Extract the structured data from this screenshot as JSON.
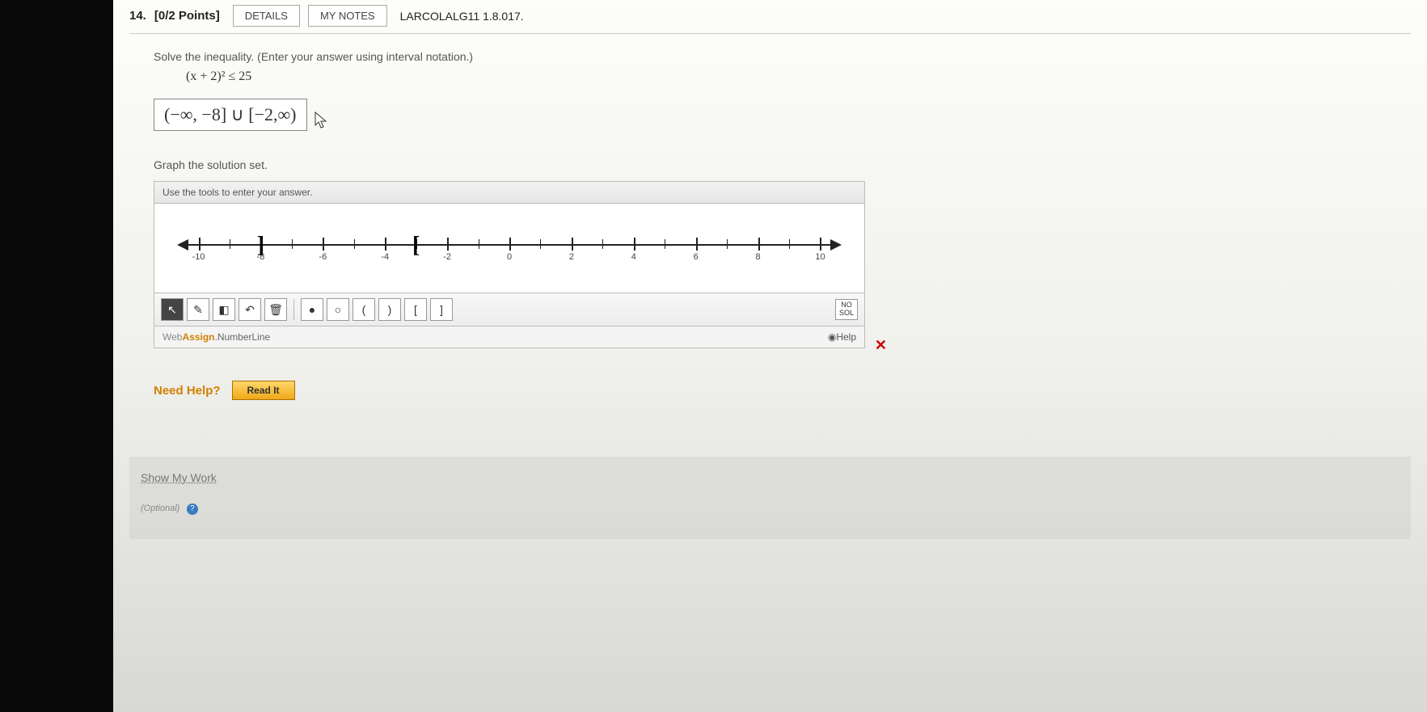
{
  "header": {
    "number": "14.",
    "points": "[0/2 Points]",
    "details_btn": "DETAILS",
    "notes_btn": "MY NOTES",
    "code": "LARCOLALG11 1.8.017."
  },
  "problem": {
    "instruction": "Solve the inequality. (Enter your answer using interval notation.)",
    "equation": "(x + 2)² ≤ 25",
    "answer": "(−∞, −8] ∪ [−2,∞)"
  },
  "graph": {
    "label": "Graph the solution set.",
    "panel_title": "Use the tools to enter your answer.",
    "ticks": [
      -10,
      -8,
      -6,
      -4,
      -2,
      0,
      2,
      4,
      6,
      8,
      10
    ],
    "brackets": [
      {
        "pos": -8,
        "sym": "]"
      },
      {
        "pos": -3,
        "sym": "["
      }
    ],
    "brand_wa": "Web",
    "brand_assign": "Assign",
    "brand_suffix": ".NumberLine",
    "help": "Help",
    "nosol_top": "NO",
    "nosol_bot": "SOL",
    "tools": {
      "pointer": "↖",
      "pencil": "✎",
      "eraser": "◧",
      "undo": "↶",
      "trash": "🗑",
      "closed_pt": "●",
      "open_pt": "○",
      "open_paren": "(",
      "close_paren": ")",
      "open_brk": "[",
      "close_brk": "]"
    }
  },
  "help": {
    "need_help": "Need Help?",
    "read_it": "Read It"
  },
  "work": {
    "title": "Show My Work",
    "optional": "(Optional)"
  },
  "close_x": "✕"
}
